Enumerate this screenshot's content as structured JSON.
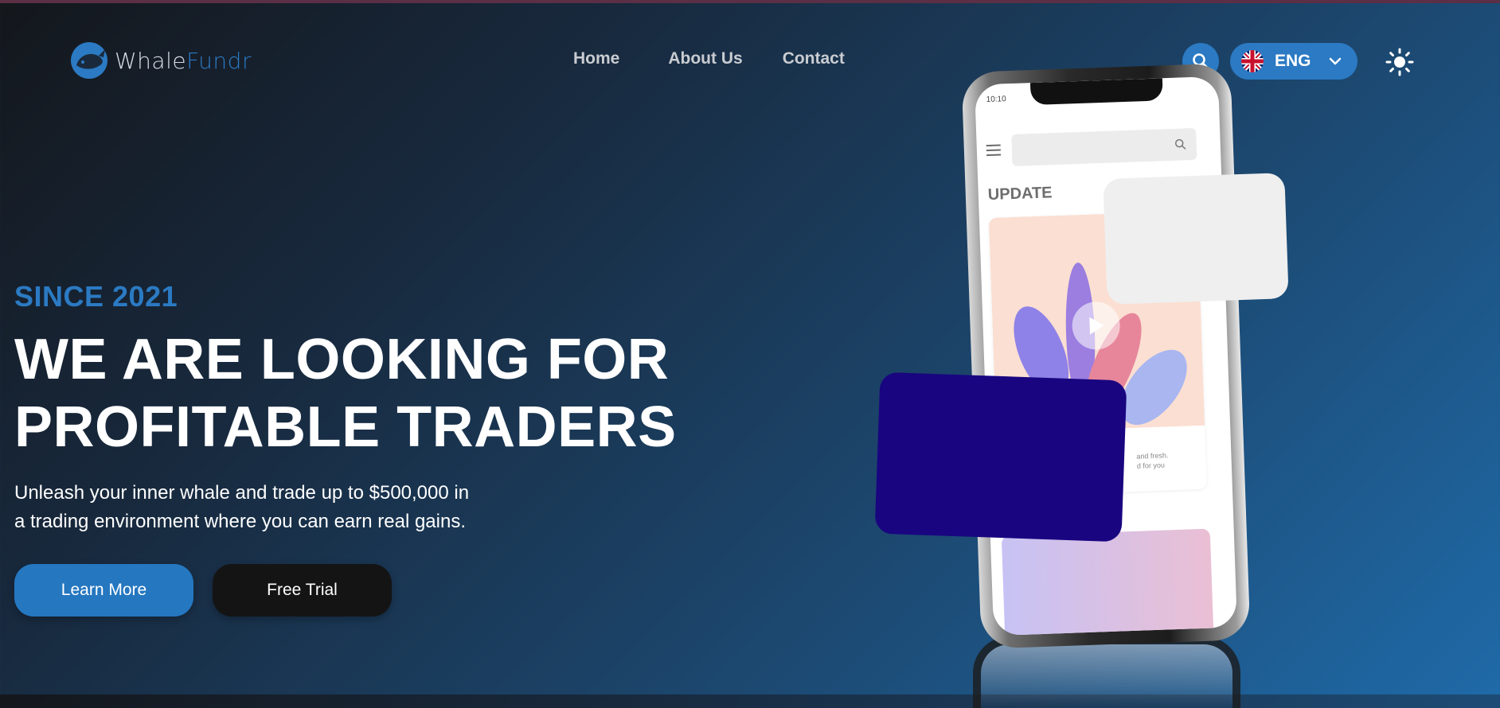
{
  "brand": {
    "name_part1": "Whale",
    "name_part2": "Fundr"
  },
  "nav": {
    "items": [
      {
        "label": "Home"
      },
      {
        "label": "About Us"
      },
      {
        "label": "Contact"
      }
    ]
  },
  "header": {
    "language_code": "ENG",
    "search_icon": "search-icon",
    "theme_icon": "sun-icon"
  },
  "hero": {
    "since": "SINCE 2021",
    "headline_line1": "WE ARE LOOKING FOR",
    "headline_line2": "PROFITABLE TRADERS",
    "subtext_line1": "Unleash your inner whale and trade up to $500,000 in",
    "subtext_line2": "a trading environment where you can earn real gains.",
    "learn_more_label": "Learn More",
    "free_trial_label": "Free Trial"
  },
  "mockup": {
    "status_time": "10:10",
    "section_title": "UPDATE",
    "card_text_line1": "and fresh.",
    "card_text_line2": "d for you"
  },
  "colors": {
    "accent": "#2b7ac3",
    "dark_card": "#190580",
    "light_card": "#efefef",
    "button_dark": "#141414"
  }
}
